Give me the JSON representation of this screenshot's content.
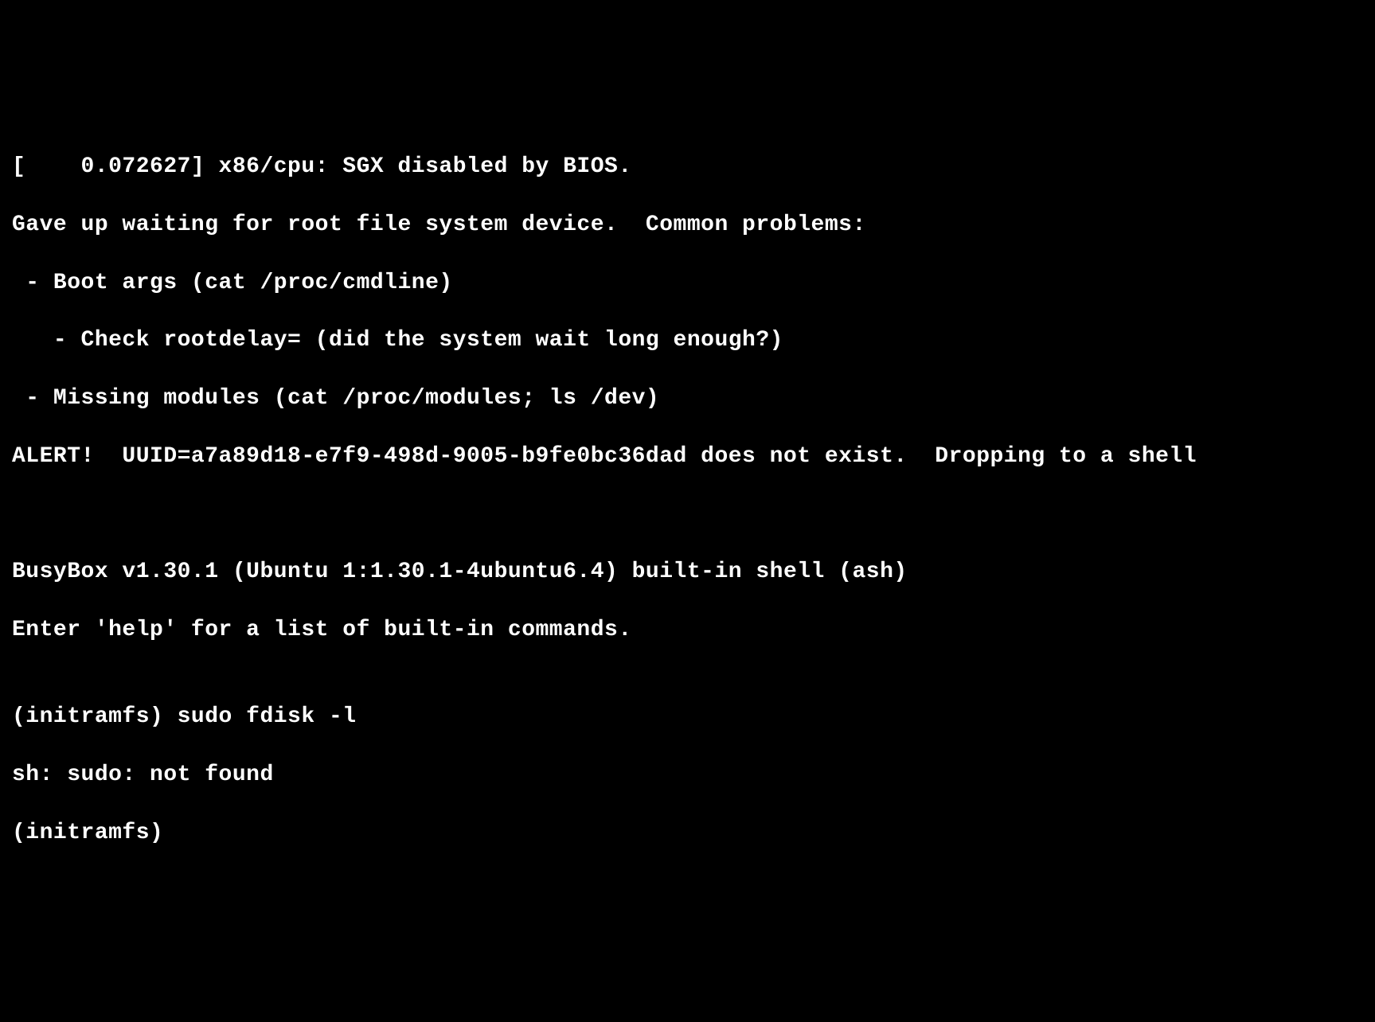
{
  "terminal": {
    "lines": [
      "[    0.072627] x86/cpu: SGX disabled by BIOS.",
      "Gave up waiting for root file system device.  Common problems:",
      " - Boot args (cat /proc/cmdline)",
      "   - Check rootdelay= (did the system wait long enough?)",
      " - Missing modules (cat /proc/modules; ls /dev)",
      "ALERT!  UUID=a7a89d18-e7f9-498d-9005-b9fe0bc36dad does not exist.  Dropping to a shell",
      "",
      "",
      "BusyBox v1.30.1 (Ubuntu 1:1.30.1-4ubuntu6.4) built-in shell (ash)",
      "Enter 'help' for a list of built-in commands.",
      "",
      "(initramfs) sudo fdisk -l",
      "sh: sudo: not found"
    ],
    "current_prompt": "(initramfs) "
  }
}
